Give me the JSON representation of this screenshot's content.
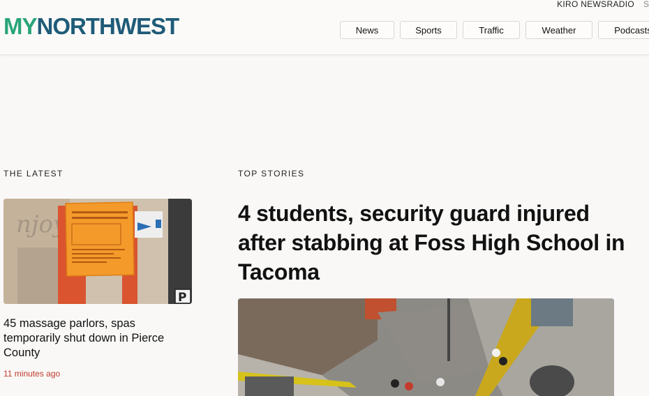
{
  "header": {
    "logo_my": "MY",
    "logo_rest": "NORTHWEST",
    "top_right_link": "KIRO NEWSRADIO",
    "top_right_overflow": "S"
  },
  "nav": {
    "items": [
      {
        "label": "News"
      },
      {
        "label": "Sports"
      },
      {
        "label": "Traffic"
      },
      {
        "label": "Weather"
      },
      {
        "label": "Podcasts"
      }
    ]
  },
  "latest": {
    "section_label": "THE LATEST",
    "article": {
      "title": "45 massage parlors, spas temporarily shut down in Pierce County",
      "time": "11 minutes ago",
      "sign_line1": "STOP WORK ORDER",
      "sign_line2": "NOTICE OF VIOLATION"
    }
  },
  "top_stories": {
    "section_label": "TOP STORIES",
    "headline": "4 students, security guard injured after stabbing at Foss High School in Tacoma"
  },
  "colors": {
    "logo_green": "#2aa57a",
    "logo_blue": "#1f5b78",
    "timestamp_red": "#c0392b"
  }
}
